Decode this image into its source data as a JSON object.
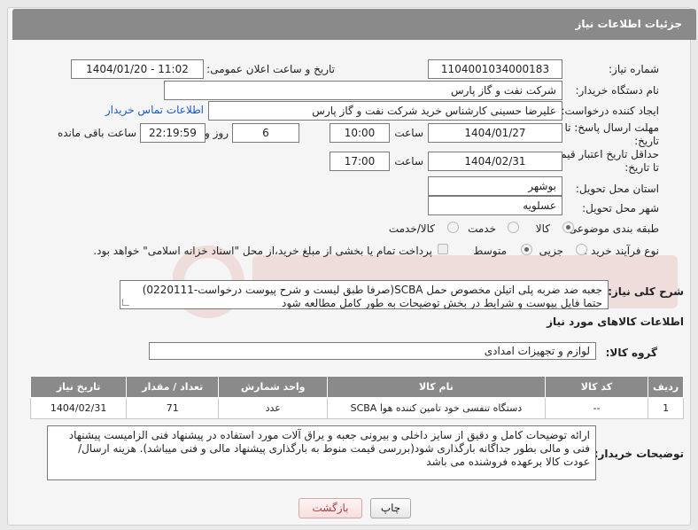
{
  "header": {
    "title": "جزئیات اطلاعات نیاز"
  },
  "fields": {
    "need_number_label": "شماره نیاز:",
    "need_number": "1104001034000183",
    "announce_label": "تاریخ و ساعت اعلان عمومی:",
    "announce_value": "1404/01/20 - 11:02",
    "buyer_org_label": "نام دستگاه خریدار:",
    "buyer_org": "شرکت نفت و گاز پارس",
    "creator_label": "ایجاد کننده درخواست:",
    "creator": "علیرضا حسینی کارشناس خرید شرکت نفت و گاز پارس",
    "contact_link": "اطلاعات تماس خریدار",
    "deadline_label": "مهلت ارسال پاسخ: تا تاریخ:",
    "deadline_date": "1404/01/27",
    "time_word": "ساعت",
    "deadline_time": "10:00",
    "days_value": "6",
    "days_and": "روز و",
    "remaining_time": "22:19:59",
    "remaining_label": "ساعت باقی مانده",
    "validity_label": "حداقل تاریخ اعتبار قیمت: تا تاریخ:",
    "validity_date": "1404/02/31",
    "validity_time": "17:00",
    "province_label": "استان محل تحویل:",
    "province": "بوشهر",
    "city_label": "شهر محل تحویل:",
    "city": "عسلویه",
    "category_label": "طبقه بندی موضوعی:",
    "category_options": [
      "کالا",
      "خدمت",
      "کالا/خدمت"
    ],
    "process_label": "نوع فرآیند خرید :",
    "process_options": [
      "جزیی",
      "متوسط"
    ],
    "payment_note": "پرداخت تمام یا بخشی از مبلغ خرید،از محل \"اسناد خزانه اسلامی\" خواهد بود.",
    "summary_label": "شرح کلی نیاز:",
    "summary_text": "جعبه ضد ضربه پلی اتیلن مخصوص حمل SCBA(صرفا طبق لیست و شرح پیوست درخواست-0220111) حتما فایل پیوست و شرایط در بخش توضیحات به طور کامل مطالعه شود",
    "goods_info_title": "اطلاعات کالاهای مورد نیاز",
    "goods_group_label": "گروه کالا:",
    "goods_group": "لوازم و تجهیزات امدادی"
  },
  "table": {
    "headers": [
      "ردیف",
      "کد کالا",
      "نام کالا",
      "واحد شمارش",
      "تعداد / مقدار",
      "تاریخ نیاز"
    ],
    "rows": [
      [
        "1",
        "--",
        "دستگاه تنفسی خود تامین کننده هوا SCBA",
        "عدد",
        "71",
        "1404/02/31"
      ]
    ]
  },
  "buyer_notes": {
    "label": "توضیحات خریدار:",
    "text": "ارائه توضیحات کامل و دقیق از سایز داخلی و بیرونی جعبه و یراق آلات مورد استفاده در پیشنهاد فنی الزامیست پیشنهاد فنی و مالی بطور جداگانه بارگذاری شود(بررسی قیمت منوط به بارگذاری پیشنهاد مالی و فنی میباشد). هزینه ارسال/عودت کالا برعهده فروشنده می باشد"
  },
  "buttons": {
    "print": "چاپ",
    "back": "بازگشت"
  }
}
